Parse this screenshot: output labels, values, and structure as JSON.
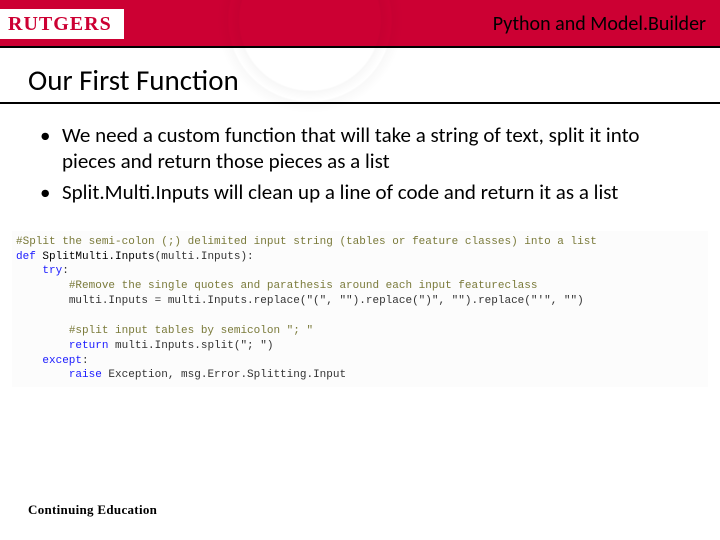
{
  "header": {
    "logo_text": "RUTGERS",
    "course_title": "Python and Model.Builder"
  },
  "slide": {
    "title": "Our First Function",
    "bullets": [
      "We need a custom function that will take a string of text, split it into pieces and return those pieces as a list",
      "Split.Multi.Inputs will clean up a line of code and return it as a list"
    ]
  },
  "code": {
    "c1": "#Split the semi-colon (;) delimited input string (tables or feature classes) into a list",
    "kw_def": "def",
    "fn_name": "SplitMulti.Inputs",
    "params": "(multi.Inputs):",
    "kw_try": "try",
    "c2": "#Remove the single quotes and parathesis around each input featureclass",
    "line_assign": "multi.Inputs = multi.Inputs.replace(\"(\", \"\").replace(\")\", \"\").replace(\"'\", \"\")",
    "c3": "#split input tables by semicolon \"; \"",
    "kw_return": "return",
    "line_return": " multi.Inputs.split(\"; \")",
    "kw_except": "except",
    "kw_raise": "raise",
    "exc": " Exception, msg.Error.Splitting.Input"
  },
  "footer": {
    "text": "Continuing Education"
  }
}
